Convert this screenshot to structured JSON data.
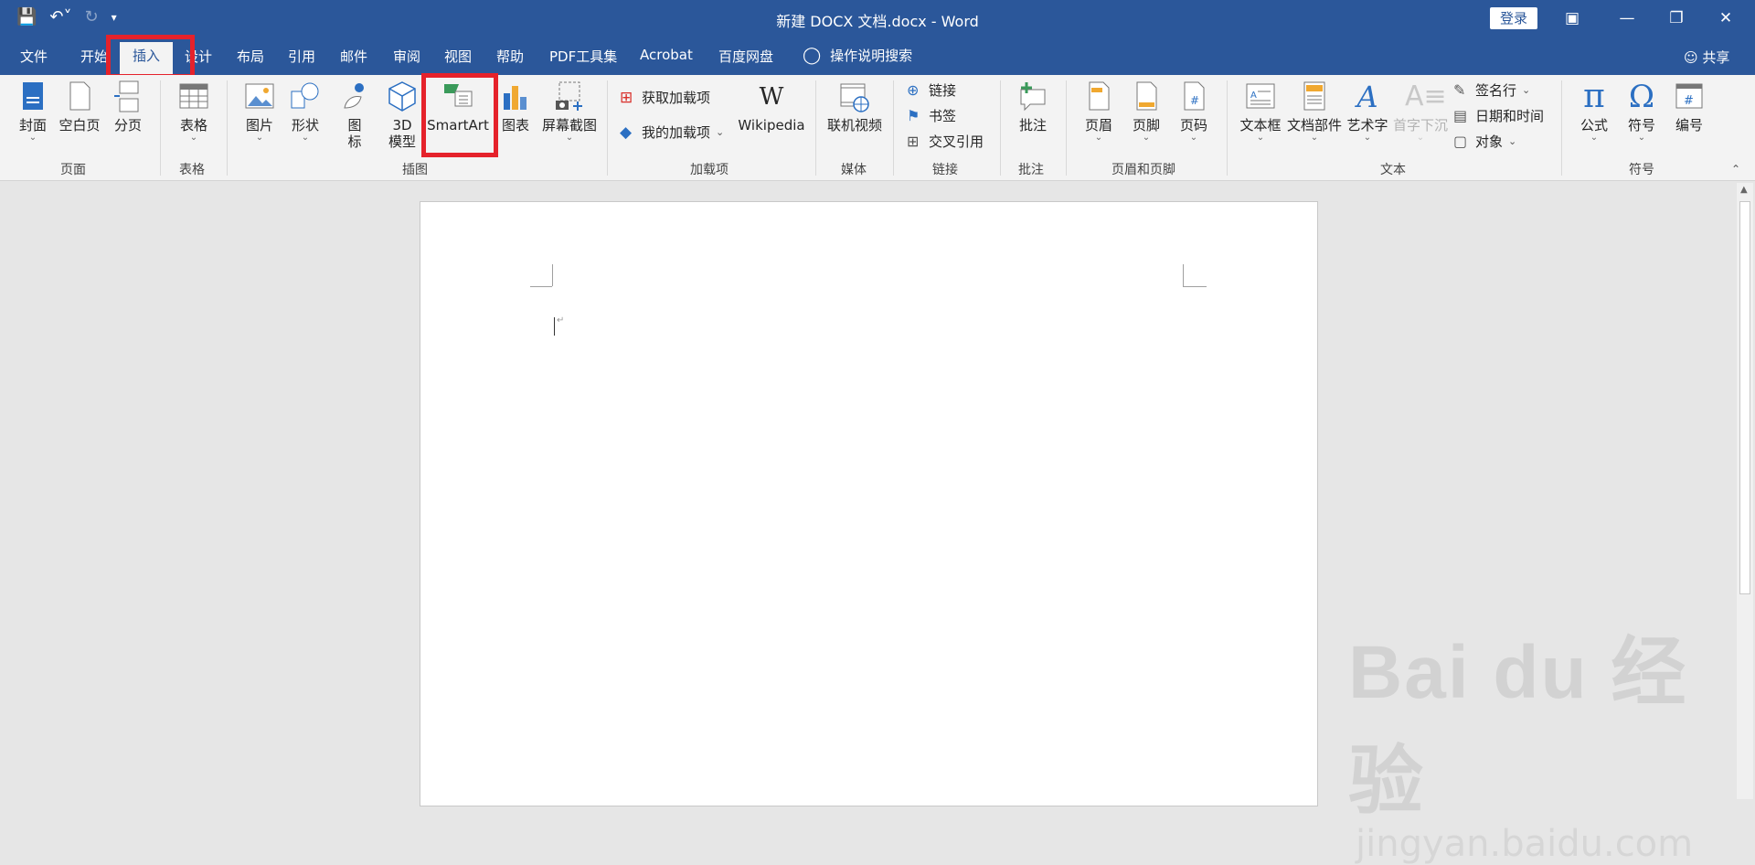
{
  "window": {
    "title": "新建 DOCX 文档.docx  -  Word",
    "login_label": "登录",
    "share_label": "共享",
    "quick_access": [
      "save-icon",
      "undo-icon",
      "redo-icon",
      "customize-icon"
    ]
  },
  "tabs": [
    {
      "label": "文件"
    },
    {
      "label": "开始"
    },
    {
      "label": "插入",
      "active": true
    },
    {
      "label": "设计"
    },
    {
      "label": "布局"
    },
    {
      "label": "引用"
    },
    {
      "label": "邮件"
    },
    {
      "label": "审阅"
    },
    {
      "label": "视图"
    },
    {
      "label": "帮助"
    },
    {
      "label": "PDF工具集"
    },
    {
      "label": "Acrobat"
    },
    {
      "label": "百度网盘"
    }
  ],
  "tell_me": "操作说明搜索",
  "ribbon": {
    "pages": {
      "label": "页面",
      "cover": "封面",
      "blank": "空白页",
      "break": "分页"
    },
    "tables": {
      "label": "表格",
      "table": "表格"
    },
    "illustrations": {
      "label": "插图",
      "picture": "图片",
      "shapes": "形状",
      "icons_1": "图",
      "icons_2": "标",
      "model_1": "3D",
      "model_2": "模型",
      "smartart": "SmartArt",
      "chart": "图表",
      "screenshot": "屏幕截图"
    },
    "addins": {
      "label": "加载项",
      "get": "获取加载项",
      "my": "我的加载项",
      "wikipedia": "Wikipedia"
    },
    "media": {
      "label": "媒体",
      "video": "联机视频"
    },
    "links": {
      "label": "链接",
      "link": "链接",
      "bookmark": "书签",
      "crossref": "交叉引用"
    },
    "comments": {
      "label": "批注",
      "comment": "批注"
    },
    "header_footer": {
      "label": "页眉和页脚",
      "header": "页眉",
      "footer": "页脚",
      "page_number": "页码"
    },
    "text": {
      "label": "文本",
      "textbox": "文本框",
      "quickparts": "文档部件",
      "wordart": "艺术字",
      "dropcap": "首字下沉",
      "signature": "签名行",
      "datetime": "日期和时间",
      "object": "对象"
    },
    "symbols": {
      "label": "符号",
      "equation": "公式",
      "symbol": "符号",
      "number": "编号"
    }
  },
  "watermark": {
    "logo": "Bai du 经验",
    "url": "jingyan.baidu.com"
  },
  "colors": {
    "brand": "#2b579a",
    "highlight": "#e5222b",
    "ribbon_bg": "#f3f3f3"
  }
}
